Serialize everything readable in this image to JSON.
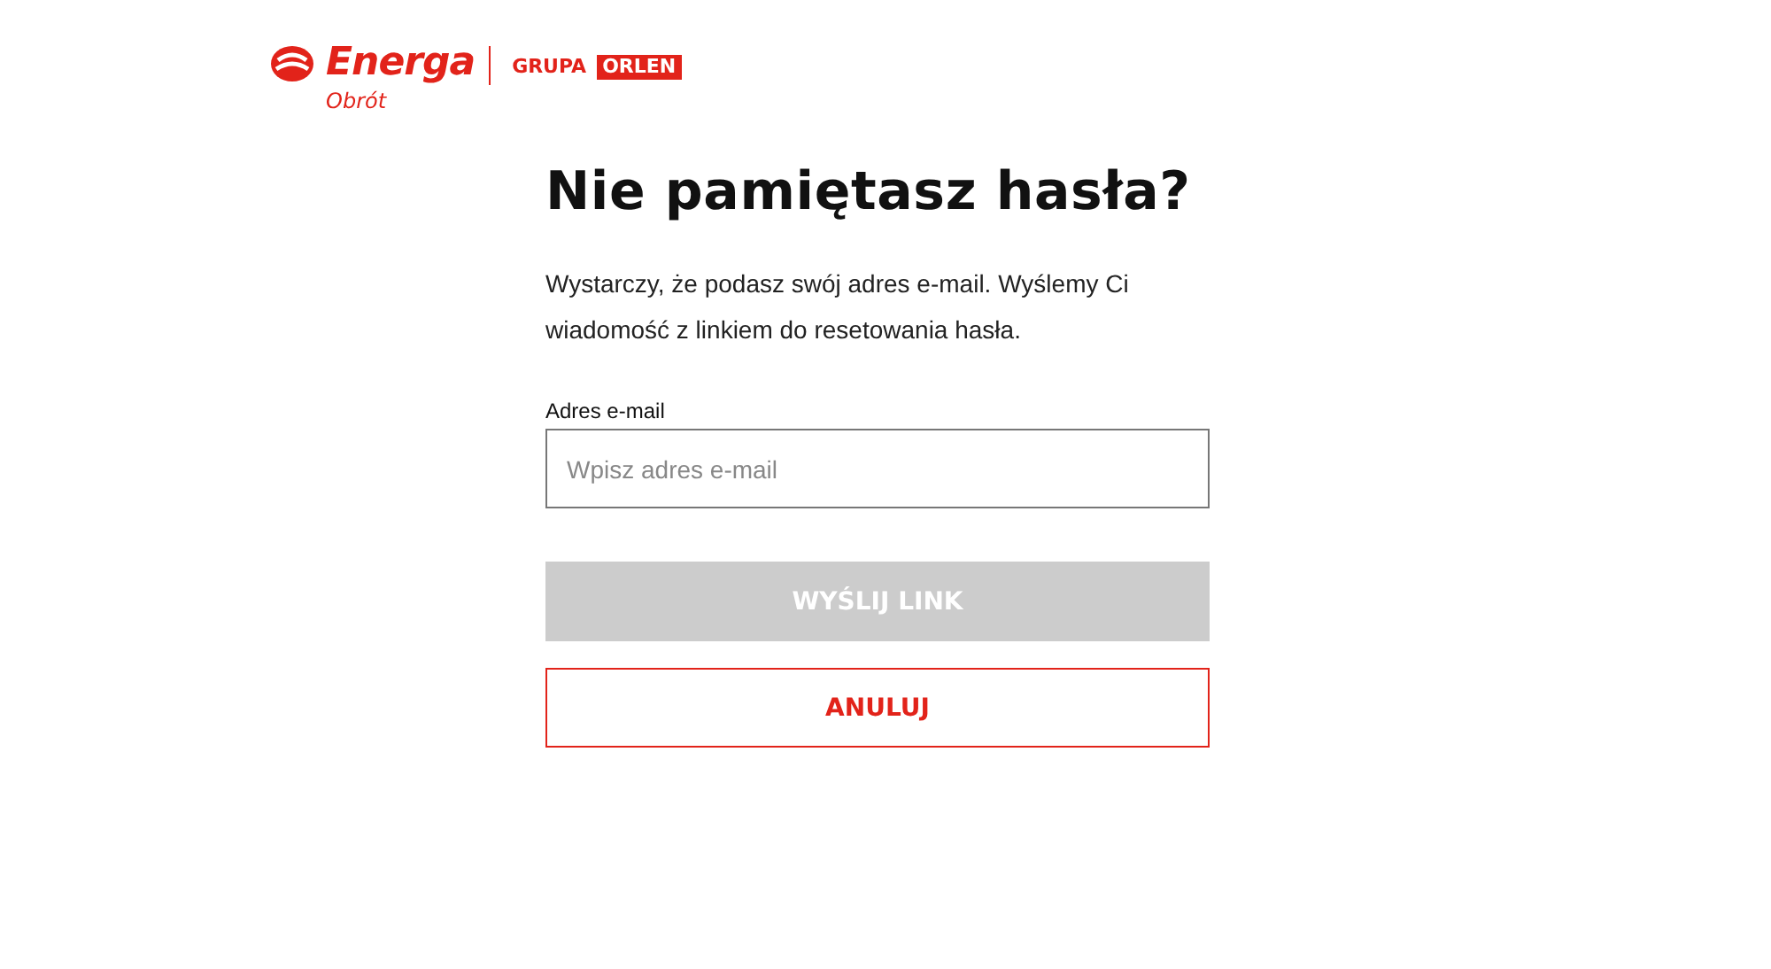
{
  "logo": {
    "brand": "Energa",
    "sub": "Obrót",
    "group": "GRUPA",
    "group_mark": "ORLEN"
  },
  "title": "Nie pamiętasz hasła?",
  "description": "Wystarczy, że podasz swój adres e-mail. Wyślemy Ci wiadomość z linkiem do resetowania hasła.",
  "email": {
    "label": "Adres e-mail",
    "placeholder": "Wpisz adres e-mail"
  },
  "submit": {
    "label": "WYŚLIJ LINK",
    "disabled": true
  },
  "cancel": {
    "label": "ANULUJ"
  }
}
